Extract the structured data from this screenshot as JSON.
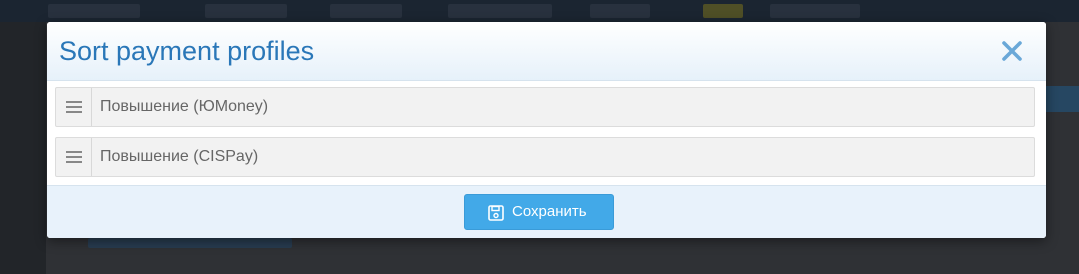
{
  "dialog": {
    "title": "Sort payment profiles",
    "close_icon": "close-icon",
    "accent_color": "#2a77b8"
  },
  "profiles": [
    {
      "label": "Повышение (ЮMoney)",
      "handle_icon": "drag-handle-icon"
    },
    {
      "label": "Повышение (CISPay)",
      "handle_icon": "drag-handle-icon"
    }
  ],
  "footer": {
    "save_label": "Сохранить",
    "save_icon": "floppy-disk-icon",
    "button_color": "#42a9e8"
  }
}
